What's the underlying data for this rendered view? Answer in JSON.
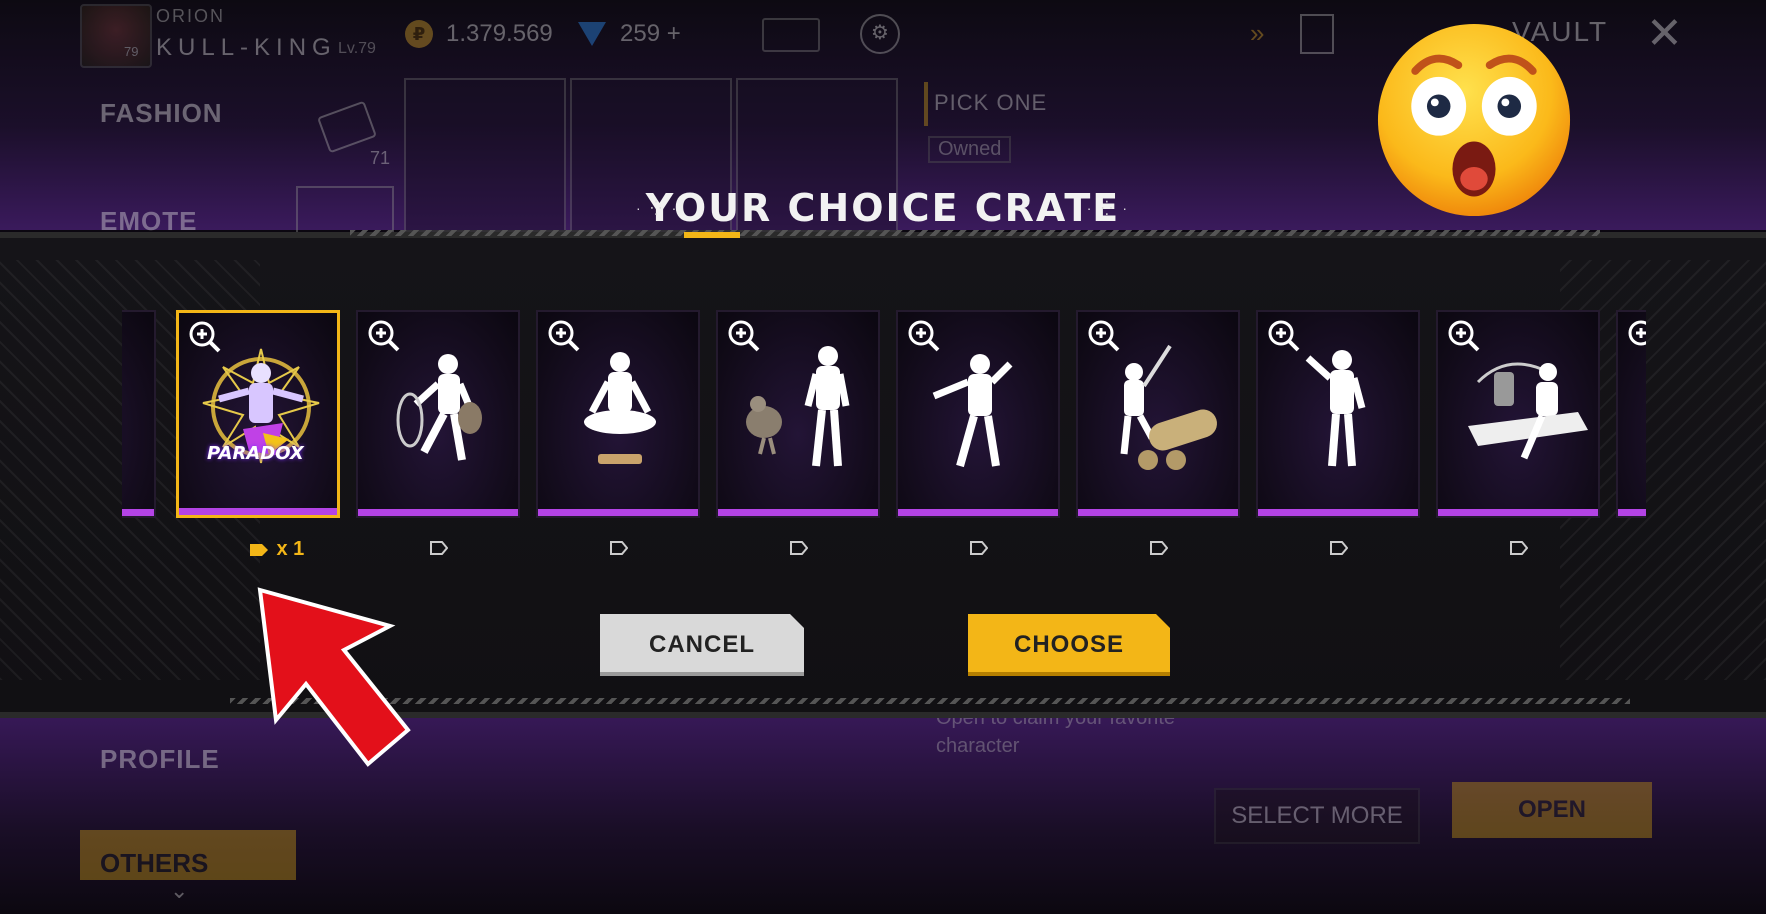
{
  "player": {
    "name_small": "ORION",
    "name": "KULL-KING",
    "level": "Lv.79",
    "avatar_level": "79"
  },
  "currency": {
    "coins": "1.379.569",
    "gems": "259 +"
  },
  "header": {
    "vault": "VAULT"
  },
  "sidebar": {
    "items": [
      "FASHION",
      "EMOTE",
      "PROFILE",
      "OTHERS"
    ]
  },
  "background": {
    "count": "71",
    "pick_one": "PICK ONE",
    "owned": "Owned",
    "description": "Open to claim your favorite character",
    "select_more": "SELECT MORE",
    "open": "OPEN"
  },
  "modal": {
    "title": "YOUR CHOICE CRATE",
    "items": [
      {
        "name": "PARADOX emote",
        "selected": true
      },
      {
        "name": "lasso emote"
      },
      {
        "name": "meditation emote"
      },
      {
        "name": "companion dance emote"
      },
      {
        "name": "dance emote"
      },
      {
        "name": "cannon emote"
      },
      {
        "name": "peace sign emote"
      },
      {
        "name": "jet emote"
      }
    ],
    "item_label": "PARADOX",
    "selected_qty": "x 1",
    "cancel": "CANCEL",
    "choose": "CHOOSE"
  },
  "colors": {
    "accent": "#f3b617",
    "rarity_bar": "#b443e6",
    "arrow": "#e3101a"
  }
}
